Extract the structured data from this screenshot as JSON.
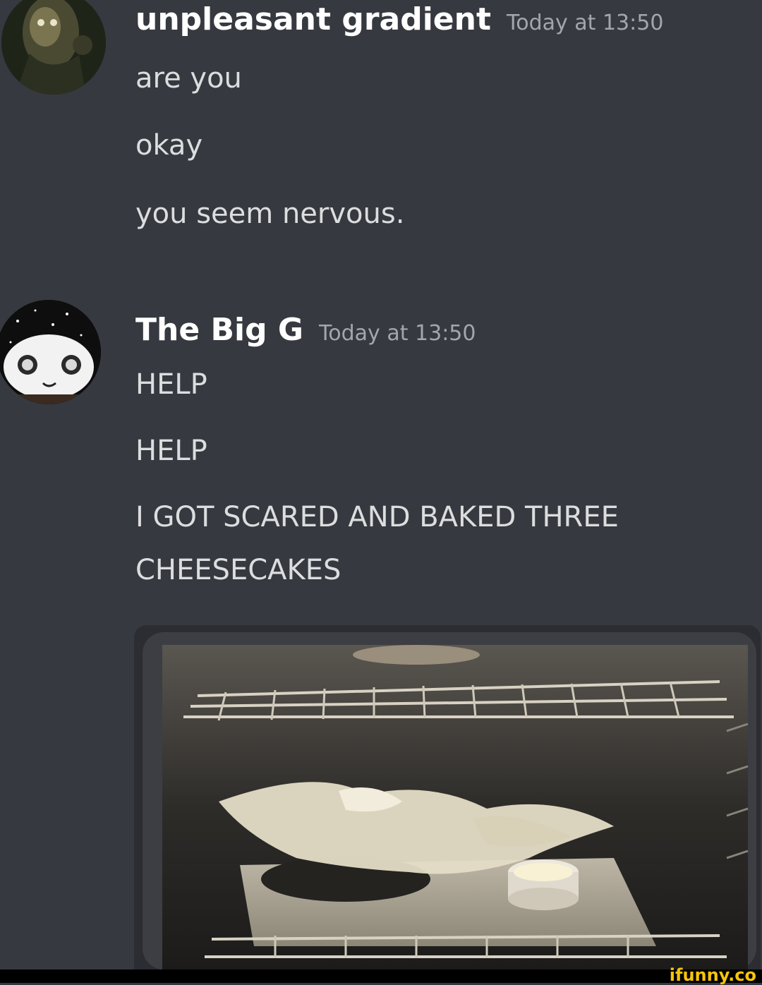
{
  "messages": [
    {
      "username": "unpleasant gradient",
      "timestamp": "Today at 13:50",
      "lines": [
        "are you",
        "okay",
        "you seem nervous."
      ]
    },
    {
      "username": "The Big G",
      "timestamp": "Today at 13:50",
      "lines": [
        "HELP",
        "HELP",
        "I GOT SCARED AND BAKED THREE",
        "CHEESECAKES"
      ]
    }
  ],
  "watermark": "ifunny.co",
  "colors": {
    "background": "#36393f",
    "username": "#ffffff",
    "timestamp": "#a3a6aa",
    "message_text": "#dcddde",
    "watermark": "#f6c40c"
  }
}
